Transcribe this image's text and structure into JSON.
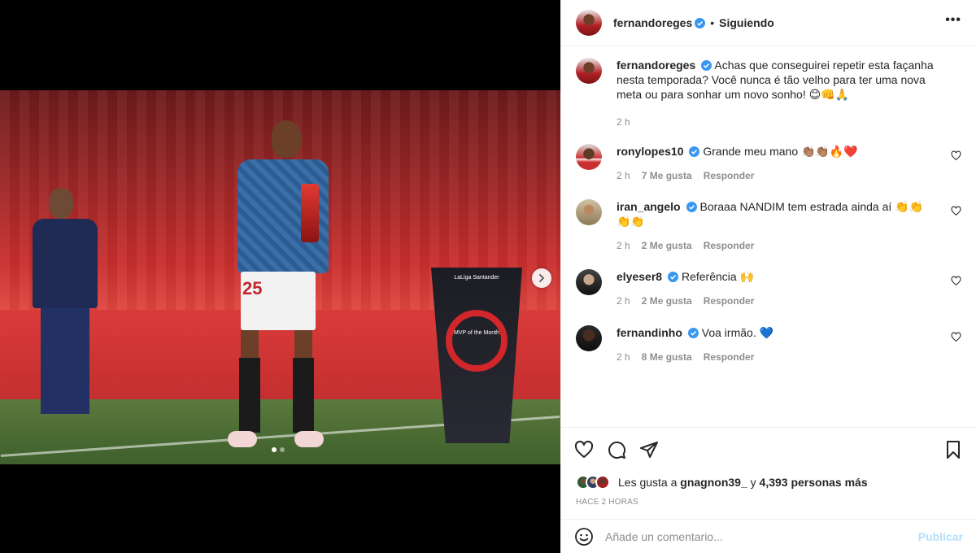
{
  "post": {
    "author": "fernandoreges",
    "follow_status": "Siguiendo",
    "header_separator": "•",
    "more_label": "•••",
    "image_alt": "Jugador con trofeo MVP of the Month",
    "board_text": "LaLiga Santander",
    "podium_text": "MVP of the Month",
    "shirt_number": "25"
  },
  "caption": {
    "username": "fernandoreges",
    "text": "Achas que conseguirei repetir esta façanha nesta temporada? Você nunca é tão velho para ter uma nova meta ou para sonhar um novo sonho! 😊👊🙏",
    "time": "2 h"
  },
  "comments": [
    {
      "username": "ronylopes10",
      "text": "Grande meu mano 👏🏽👏🏽🔥❤️",
      "time": "2 h",
      "likes": "7 Me gusta",
      "reply": "Responder"
    },
    {
      "username": "iran_angelo",
      "text": "Boraaa NANDIM tem estrada ainda aí 👏👏👏👏",
      "time": "2 h",
      "likes": "2 Me gusta",
      "reply": "Responder"
    },
    {
      "username": "elyeser8",
      "text": "Referência 🙌",
      "time": "2 h",
      "likes": "2 Me gusta",
      "reply": "Responder"
    },
    {
      "username": "fernandinho",
      "text": "Voa irmão. 💙",
      "time": "2 h",
      "likes": "8 Me gusta",
      "reply": "Responder"
    }
  ],
  "likes_summary": {
    "prefix": "Les gusta a",
    "user": "gnagnon39_",
    "suffix": "y",
    "count": "4,393 personas más"
  },
  "timestamp": "HACE 2 HORAS",
  "add_comment": {
    "placeholder": "Añade un comentario...",
    "post_label": "Publicar"
  },
  "colors": {
    "verified": "#3897f0",
    "post_button": "#b2dffc",
    "meta": "#8e8e8e"
  }
}
